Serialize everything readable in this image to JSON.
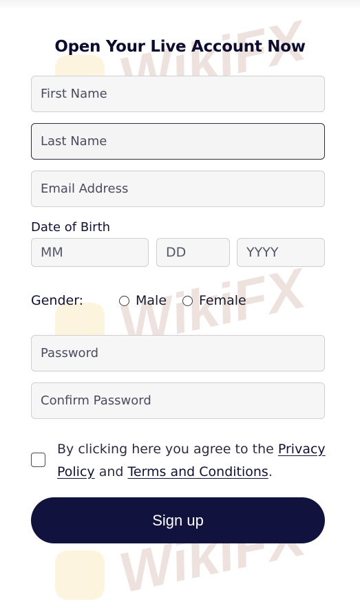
{
  "form": {
    "title": "Open Your Live Account Now",
    "first_name_placeholder": "First Name",
    "last_name_placeholder": "Last Name",
    "email_placeholder": "Email Address",
    "dob_label": "Date of Birth",
    "dob_month_placeholder": "MM",
    "dob_day_placeholder": "DD",
    "dob_year_placeholder": "YYYY",
    "gender_label": "Gender:",
    "gender_options": [
      "Male",
      "Female"
    ],
    "password_placeholder": "Password",
    "confirm_password_placeholder": "Confirm Password",
    "consent_text_prefix": "By clicking here you agree to the ",
    "privacy_link_label": "Privacy Policy",
    "consent_text_and": " and ",
    "terms_link_label": "Terms and Conditions",
    "consent_text_suffix": ".",
    "submit_label": "Sign up"
  },
  "watermark": {
    "text": "WikiFX"
  },
  "colors": {
    "brand_dark": "#12123f",
    "title": "#0b0c2e",
    "field_bg": "#f6f6f7",
    "field_border": "#cfcfd3",
    "watermark_logo": "#f3b319",
    "watermark_text": "#8a3b1f"
  }
}
